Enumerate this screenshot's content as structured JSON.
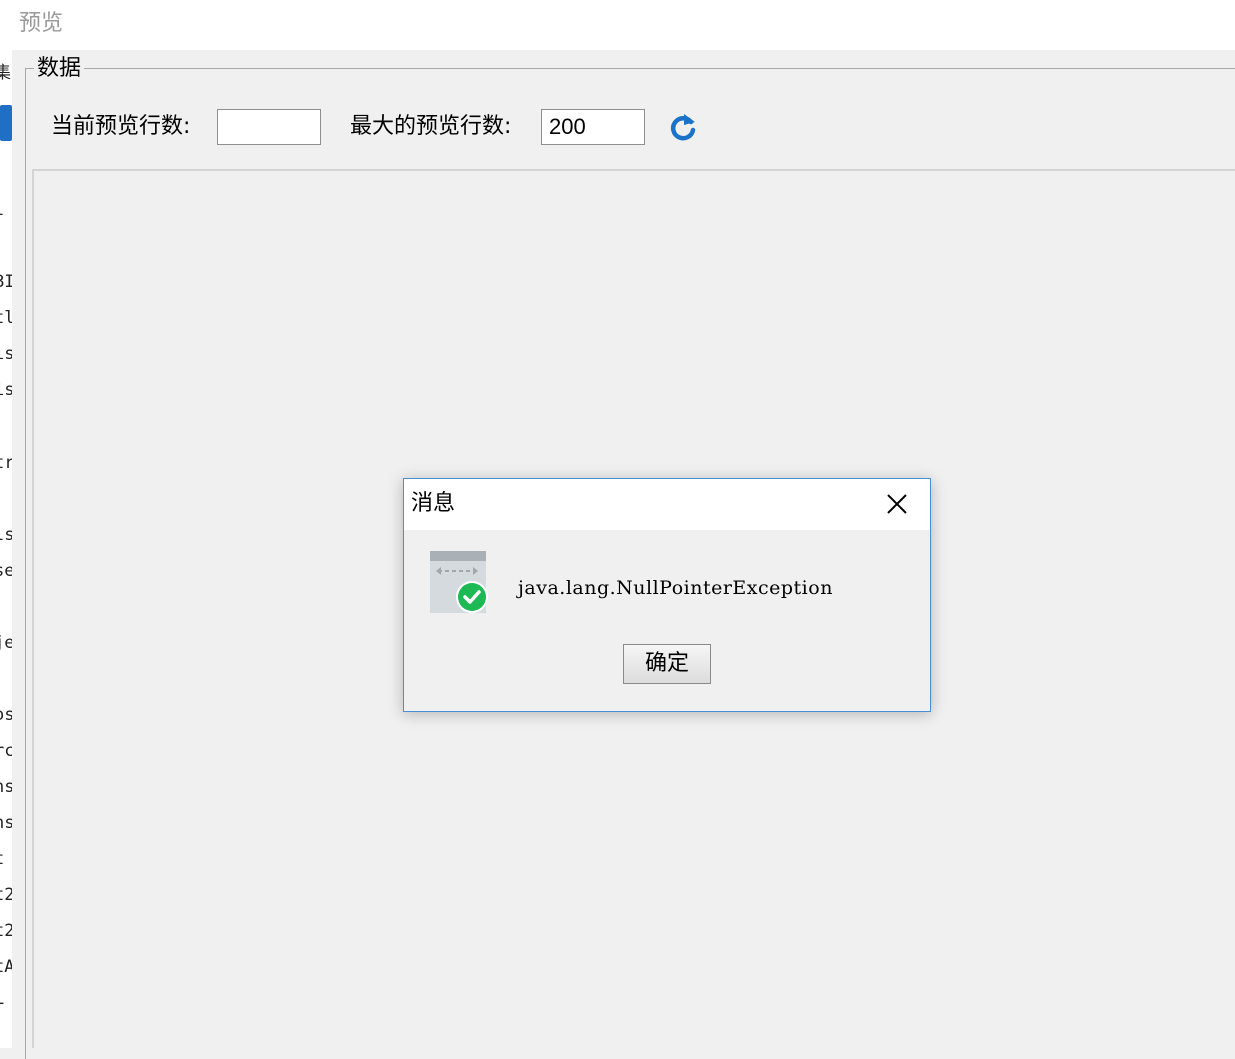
{
  "window": {
    "title": "预览"
  },
  "background_window": {
    "fragments": [
      "集",
      "l",
      "BI",
      "tl",
      "is",
      "is",
      "tr",
      "ls",
      "se",
      "je",
      "os",
      "rc",
      "ns",
      "ns",
      "t",
      "t2",
      "t2",
      "tA",
      "L"
    ]
  },
  "data_group": {
    "title": "数据",
    "current_rows_label": "当前预览行数:",
    "current_rows_value": "",
    "max_rows_label": "最大的预览行数:",
    "max_rows_value": "200",
    "refresh_icon": "refresh-icon"
  },
  "dialog": {
    "title": "消息",
    "message": "java.lang.NullPointerException",
    "ok_label": "确定",
    "icon": "success-check-icon",
    "close_icon": "close-icon"
  },
  "colors": {
    "dialog_border": "#4a8fd3",
    "refresh_blue": "#1a73c8",
    "check_green": "#1db954"
  }
}
